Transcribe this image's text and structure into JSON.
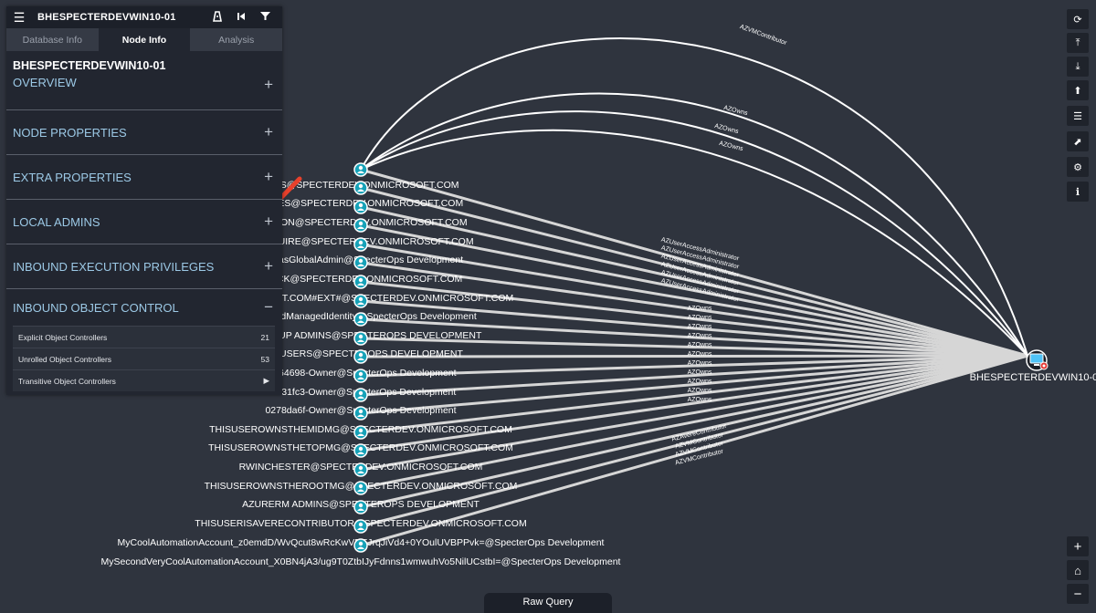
{
  "panel": {
    "title": "BHESPECTERDEVWIN10-01",
    "tabs": [
      {
        "label": "Database Info"
      },
      {
        "label": "Node Info"
      },
      {
        "label": "Analysis"
      }
    ],
    "node_name": "BHESPECTERDEVWIN10-01",
    "sections": [
      {
        "label": "OVERVIEW"
      },
      {
        "label": "NODE PROPERTIES"
      },
      {
        "label": "EXTRA PROPERTIES"
      },
      {
        "label": "LOCAL ADMINS"
      },
      {
        "label": "INBOUND EXECUTION PRIVILEGES"
      },
      {
        "label": "INBOUND OBJECT CONTROL"
      }
    ],
    "sub_items": [
      {
        "label": "Explicit Object Controllers",
        "count": "21"
      },
      {
        "label": "Unrolled Object Controllers",
        "count": "53"
      },
      {
        "label": "Transitive Object Controllers",
        "count": "▶"
      }
    ]
  },
  "graph": {
    "target_label": "BHESPECTERDEVWIN10-01",
    "curved_edge_labels": [
      "AZVMContributor",
      "AZOwns",
      "AZOwns",
      "AZOwns"
    ],
    "node_labels": [
      "...INS@SPECTERDEV.ONMICROSOFT.COM",
      "...LEES@SPECTERDEV.ONMICROSOFT.COM",
      "...ELSON@SPECTERDEV.ONMICROSOFT.COM",
      "...MCGUIRE@SPECTERDEV.ONMICROSOFT.COM",
      "...pHasGlobalAdmin@SpecterOps Development",
      "...INCK@SPECTERDEV.ONMICROSOFT.COM",
      "...ONMICROSOFT.COM#EXT#@SPECTERDEV.ONMICROSOFT.COM",
      "...ssignedManagedIdentity@SpecterOps Development",
      "...E GROUP ADMINS@SPECTEROPS DEVELOPMENT",
      "...LL USERS@SPECTEROPS DEVELOPMENT",
      "...b64698-Owner@SpecterOps Development",
      "0b031fc3-Owner@SpecterOps Development",
      "0278da6f-Owner@SpecterOps Development",
      "THISUSEROWNSTHEMIDMG@SPECTERDEV.ONMICROSOFT.COM",
      "THISUSEROWNSTHETOPMG@SPECTERDEV.ONMICROSOFT.COM",
      "RWINCHESTER@SPECTERDEV.ONMICROSOFT.COM",
      "THISUSEROWNSTHEROOTMG@SPECTERDEV.ONMICROSOFT.COM",
      "AZURERM ADMINS@SPECTEROPS DEVELOPMENT",
      "THISUSERISAVERECONTRIBUTOR@SPECTERDEV.ONMICROSOFT.COM",
      "MyCoolAutomationAccount_z0emdD/WvQcut8wRcKwVRFJrqJiVd4+0YOulUVBPPvk=@SpecterOps Development",
      "MySecondVeryCoolAutomationAccount_X0BN4jA3/ug9T0ZtbIJyFdnns1wmwuhVo5NilUCstbI=@SpecterOps Development"
    ],
    "straight_edge_labels": [
      "AZUserAccessAdministrator",
      "AZUserAccessAdministrator",
      "AZUserAccessAdministrator",
      "AZUserAccessAdministrator",
      "AZUserAccessAdministrator",
      "AZUserAccessAdministrator",
      "AZOwns",
      "AZOwns",
      "AZOwns",
      "AZOwns",
      "AZOwns",
      "AZOwns",
      "AZOwns",
      "AZOwns",
      "AZOwns",
      "AZOwns",
      "AZOwns",
      "AZAvereContributor",
      "AZVMContributor",
      "AZVMContributor",
      "AZVMContributor"
    ]
  },
  "toolbar": {
    "icons": [
      "refresh-icon",
      "export-icon",
      "import-icon",
      "upload-icon",
      "list-icon",
      "chart-icon",
      "settings-icon",
      "info-icon"
    ],
    "glyphs": [
      "⟳",
      "⤒",
      "⤓",
      "⬆",
      "☰",
      "⬈",
      "⚙",
      "ℹ"
    ]
  },
  "zoom": {
    "in": "+",
    "home": "⌂",
    "out": "−"
  },
  "raw_query_label": "Raw Query"
}
